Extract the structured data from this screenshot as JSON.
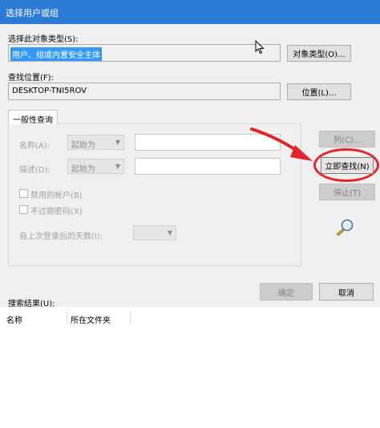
{
  "window": {
    "title": "选择用户或组"
  },
  "object_type": {
    "label": "选择此对象类型(S):",
    "value": "用户、组或内置安全主体",
    "button": "对象类型(O)..."
  },
  "location": {
    "label": "查找位置(F):",
    "value": "DESKTOP-TNI5ROV",
    "button": "位置(L)..."
  },
  "query_tab": {
    "label": "一般性查询"
  },
  "name_row": {
    "label": "名称(A):",
    "combo": "起始为",
    "value": ""
  },
  "desc_row": {
    "label": "描述(D):",
    "combo": "起始为",
    "value": ""
  },
  "checkboxes": [
    {
      "label": "禁用的帐户(B)",
      "checked": false
    },
    {
      "label": "不过期密码(X)",
      "checked": false
    }
  ],
  "days_row": {
    "label": "自上次登录后的天数(I):",
    "combo": ""
  },
  "side_buttons": {
    "columns": "列(C)...",
    "find_now": "立即查找(N)",
    "stop": "停止(T)"
  },
  "footer": {
    "ok": "确定",
    "cancel": "取消"
  },
  "results": {
    "label": "搜索结果(U):",
    "columns": [
      "名称",
      "所在文件夹"
    ]
  },
  "colors": {
    "titlebar": "#2b7bd4",
    "highlight": "#e0262b",
    "selection": "#3399ff"
  }
}
